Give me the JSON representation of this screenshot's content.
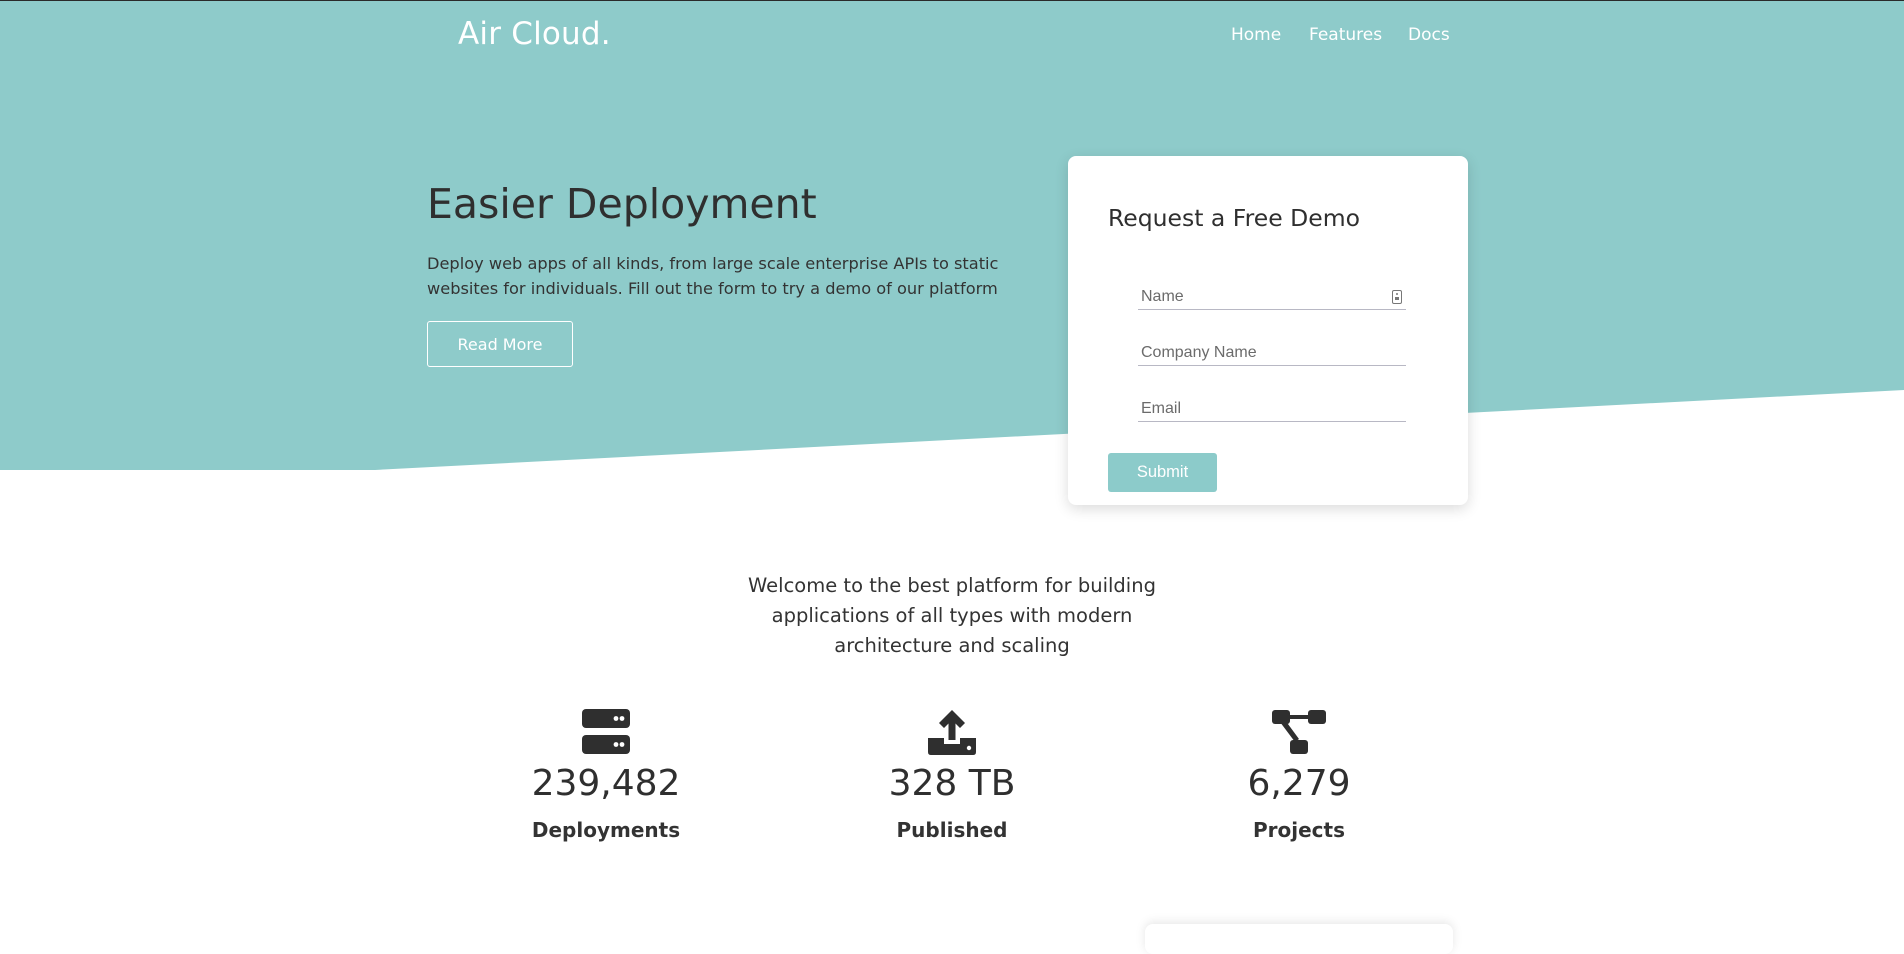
{
  "colors": {
    "hero_bg": "#8ecbca",
    "accent": "#8ccbca",
    "text_dark": "#2f2f2f",
    "white": "#ffffff"
  },
  "nav": {
    "brand": "Air Cloud.",
    "links": [
      "Home",
      "Features",
      "Docs"
    ]
  },
  "hero": {
    "title": "Easier Deployment",
    "description": "Deploy web apps of all kinds, from large scale enterprise APIs to static websites for individuals. Fill out the form to try a demo of our platform",
    "read_more_label": "Read More"
  },
  "demo_form": {
    "title": "Request a Free Demo",
    "fields": {
      "name_placeholder": "Name",
      "company_placeholder": "Company Name",
      "email_placeholder": "Email"
    },
    "submit_label": "Submit"
  },
  "welcome_text": "Welcome to the best platform for building applications of all types with modern architecture and scaling",
  "stats": [
    {
      "icon": "server-icon",
      "value": "239,482",
      "label": "Deployments"
    },
    {
      "icon": "upload-icon",
      "value": "328 TB",
      "label": "Published"
    },
    {
      "icon": "project-diagram-icon",
      "value": "6,279",
      "label": "Projects"
    }
  ]
}
